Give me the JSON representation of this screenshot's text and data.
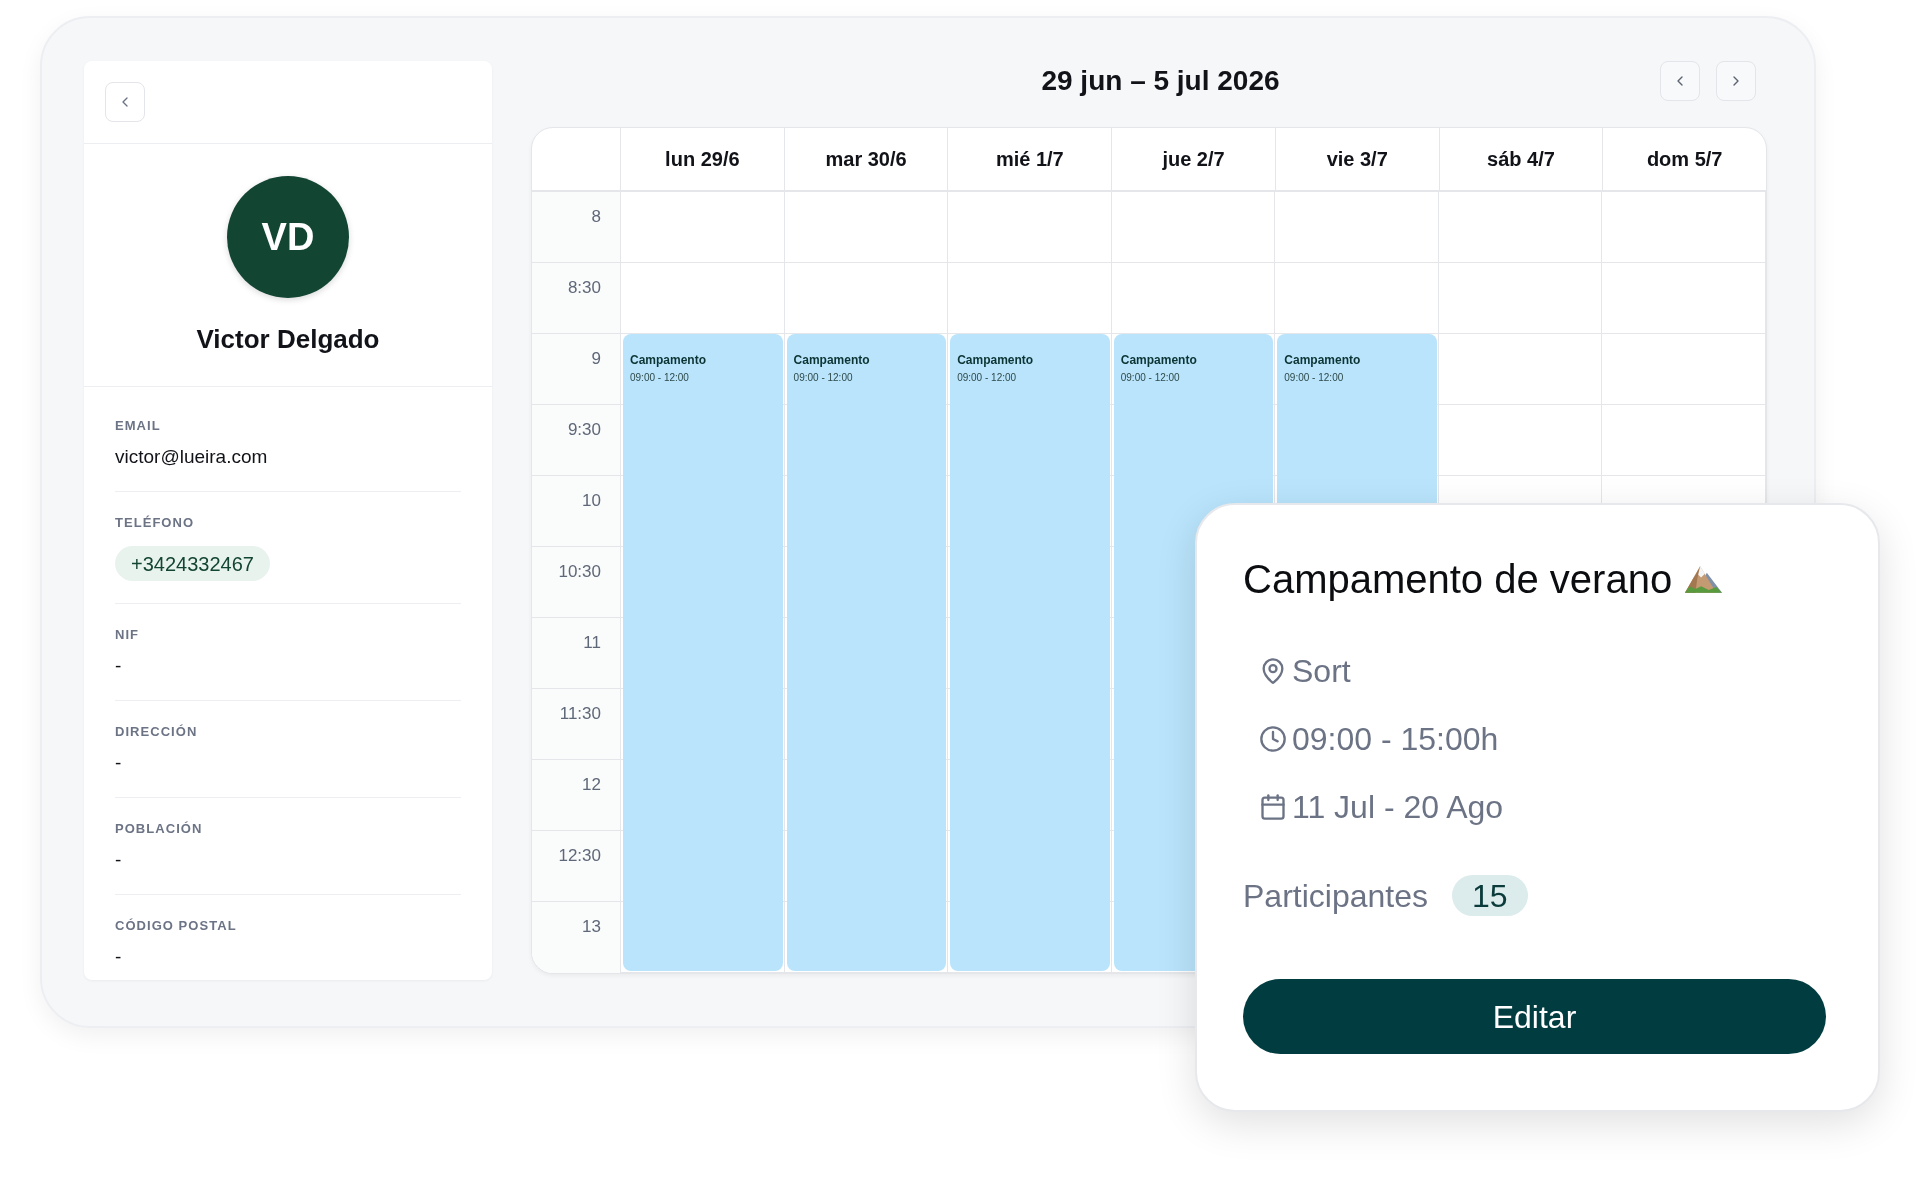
{
  "profile_panel": {
    "avatar": {
      "initials": "VD"
    },
    "name": "Victor Delgado",
    "fields": [
      {
        "label": "EMAIL",
        "value": "victor@lueira.com",
        "kind": "text"
      },
      {
        "label": "TELÉFONO",
        "value": "+3424332467",
        "kind": "pill"
      },
      {
        "label": "NIF",
        "value": "-",
        "kind": "text"
      },
      {
        "label": "DIRECCIÓN",
        "value": "-",
        "kind": "text"
      },
      {
        "label": "POBLACIÓN",
        "value": "-",
        "kind": "text"
      },
      {
        "label": "CÓDIGO POSTAL",
        "value": "-",
        "kind": "text"
      }
    ]
  },
  "calendar": {
    "title": "29 jun – 5 jul 2026",
    "days": [
      {
        "label": "lun 29/6",
        "events": [
          {
            "title": "Campamento",
            "time": "09:00 - 12:00"
          }
        ]
      },
      {
        "label": "mar 30/6",
        "events": [
          {
            "title": "Campamento",
            "time": "09:00 - 12:00"
          }
        ]
      },
      {
        "label": "mié 1/7",
        "events": [
          {
            "title": "Campamento",
            "time": "09:00 - 12:00"
          }
        ]
      },
      {
        "label": "jue 2/7",
        "events": [
          {
            "title": "Campamento",
            "time": "09:00 - 12:00"
          }
        ]
      },
      {
        "label": "vie 3/7",
        "events": [
          {
            "title": "Campamento",
            "time": "09:00 - 12:00"
          }
        ]
      },
      {
        "label": "sáb 4/7"
      },
      {
        "label": "dom 5/7"
      }
    ],
    "times": [
      "8",
      "8:30",
      "9",
      "9:30",
      "10",
      "10:30",
      "11",
      "11:30",
      "12",
      "12:30",
      "13"
    ]
  },
  "event_popup": {
    "title": "Campamento de verano",
    "details": [
      {
        "kind": "location",
        "text": "Sort"
      },
      {
        "kind": "time",
        "text": "09:00 - 15:00h"
      },
      {
        "kind": "date",
        "text": "11 Jul - 20 Ago"
      }
    ],
    "participants": {
      "label": "Participantes",
      "count": "15"
    },
    "button": "Editar"
  }
}
